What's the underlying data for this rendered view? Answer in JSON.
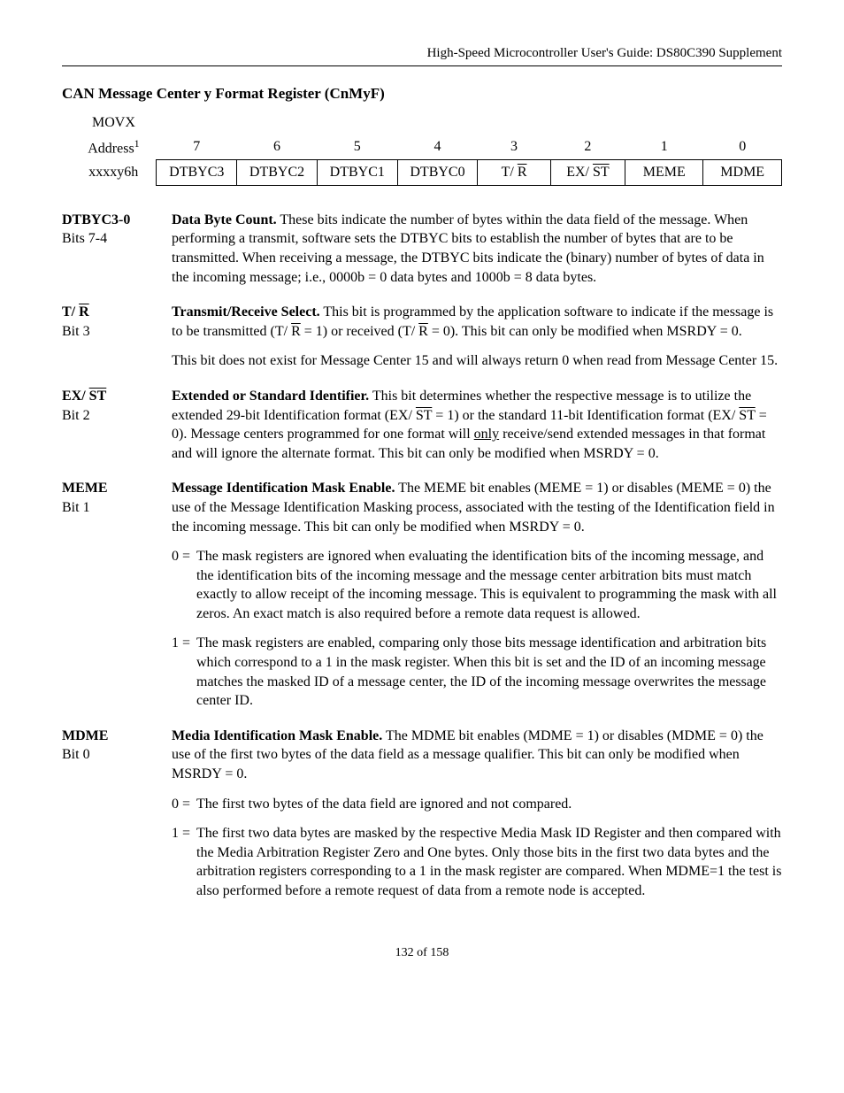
{
  "header": "High-Speed Microcontroller User's Guide: DS80C390 Supplement",
  "section_title": "CAN Message Center y Format Register (CnMyF)",
  "reg_table": {
    "row1_left_top": "MOVX",
    "row1_left_bottom": "Address",
    "row1_left_sup": "1",
    "bits": [
      "7",
      "6",
      "5",
      "4",
      "3",
      "2",
      "1",
      "0"
    ],
    "addr": "xxxxy6h",
    "fields": [
      "DTBYC3",
      "DTBYC2",
      "DTBYC1",
      "DTBYC0",
      "T/ R",
      "EX/ ST",
      "MEME",
      "MDME"
    ],
    "overline_idx": [
      4,
      5
    ]
  },
  "defs": [
    {
      "name": "DTBYC3-0",
      "bit": "Bits 7-4",
      "paras": [
        {
          "lead": "Data Byte Count.",
          "text": " These bits indicate the number of bytes within the data field of the message. When performing a transmit, software sets the DTBYC bits to establish the number of bytes that are to be transmitted. When receiving a message, the DTBYC bits indicate the (binary) number of bytes of data in the incoming message; i.e., 0000b = 0 data bytes and 1000b = 8 data bytes."
        }
      ]
    },
    {
      "name_html": "T/ <span class=\"overline\">R</span>",
      "bit": "Bit 3",
      "paras": [
        {
          "lead": "Transmit/Receive Select.",
          "text_html": " This bit is programmed by the application software to indicate if the message is to be transmitted (T/ <span class=\"overline\">R</span> = 1) or received (T/ <span class=\"overline\">R</span> = 0). This bit can only be modified when MSRDY = 0."
        },
        {
          "text": "This bit does not exist for Message Center 15 and will always return 0 when read from Message Center 15."
        }
      ]
    },
    {
      "name_html": "EX/ <span class=\"overline\">ST</span>",
      "bit": "Bit 2",
      "paras": [
        {
          "lead": "Extended or Standard Identifier.",
          "text_html": " This bit determines whether the respective message is to utilize the extended 29-bit Identification format (EX/ <span class=\"overline\">ST</span>  = 1) or the standard 11-bit Identification format (EX/ <span class=\"overline\">ST</span>  = 0). Message centers programmed for one format will <span class=\"under\">only</span> receive/send extended messages in that format and will ignore the alternate format. This bit can only be modified when MSRDY = 0."
        }
      ]
    },
    {
      "name": "MEME",
      "bit": "Bit 1",
      "paras": [
        {
          "lead": "Message Identification Mask Enable.",
          "text": "  The MEME bit enables (MEME = 1) or disables (MEME = 0) the use of the Message Identification Masking process, associated with the testing of the Identification field in the incoming message. This bit can only be modified when MSRDY = 0."
        }
      ],
      "values": [
        {
          "k": "0 =",
          "d": "The mask registers are ignored when evaluating the identification bits of the incoming message, and the identification bits of the incoming message and the message center arbitration bits must match exactly to allow receipt of the incoming message. This is equivalent to programming the mask with all zeros. An exact match is also required before a remote data request is allowed."
        },
        {
          "k": "1 =",
          "d": "The mask registers are enabled, comparing only those bits message identification and arbitration bits which correspond to a 1 in the mask register. When this bit is set and the ID of an incoming message matches the masked ID of a message center, the ID of the incoming message overwrites the message center ID."
        }
      ]
    },
    {
      "name": "MDME",
      "bit": "Bit 0",
      "paras": [
        {
          "lead": "Media Identification Mask Enable.",
          "text": "  The MDME bit enables (MDME = 1) or disables (MDME = 0) the use of the first two bytes of the data field as a message qualifier. This bit can only be modified when MSRDY = 0."
        }
      ],
      "values": [
        {
          "k": "0 =",
          "d": "The first two bytes of the data field are ignored and not compared."
        },
        {
          "k": "1 =",
          "d": "The first two data bytes are masked by the respective Media Mask ID Register and then compared with the Media Arbitration Register Zero and One bytes. Only those bits in the first two data bytes and the arbitration registers corresponding to a 1 in the mask register are compared. When MDME=1 the test is also performed before a remote request of data from a remote node is accepted."
        }
      ]
    }
  ],
  "page_num": "132 of 158"
}
